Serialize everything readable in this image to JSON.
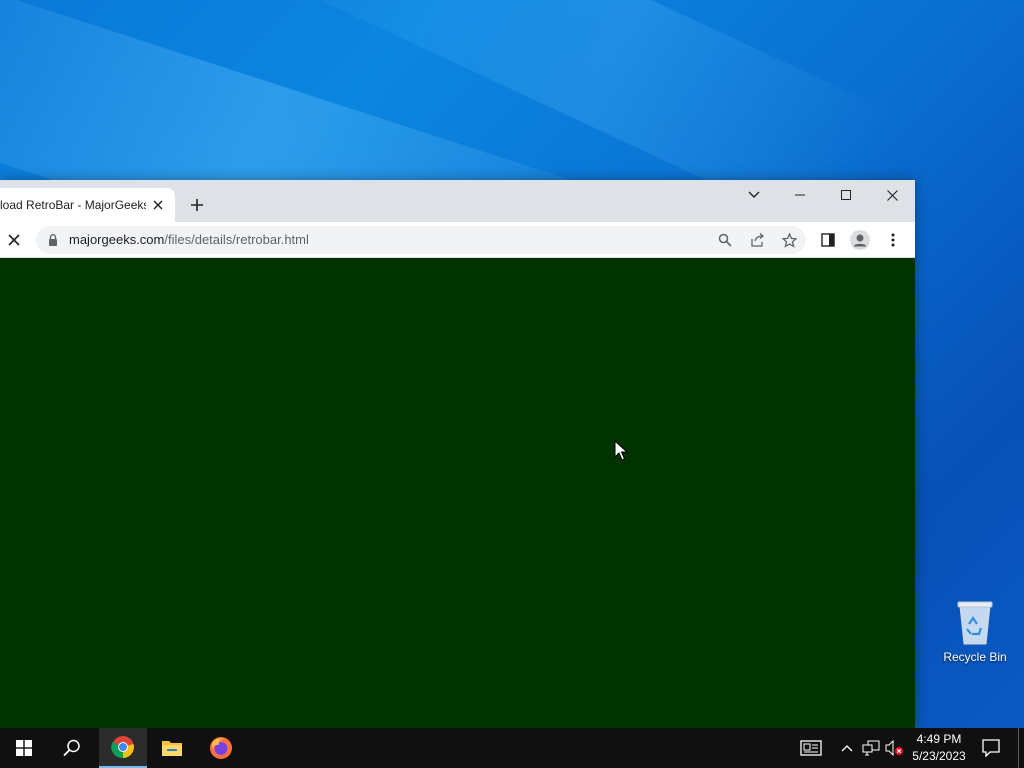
{
  "browser": {
    "tab_title": "load RetroBar - MajorGeeks",
    "url_host": "majorgeeks.com",
    "url_path": "/files/details/retrobar.html"
  },
  "desktop": {
    "recycle_bin_label": "Recycle Bin"
  },
  "taskbar": {
    "time": "4:49 PM",
    "date": "5/23/2023",
    "apps": [
      "start-icon",
      "search-icon",
      "chrome-icon",
      "file-explorer-icon",
      "firefox-icon"
    ]
  },
  "colors": {
    "page_bg": "#003300",
    "tabstrip": "#dee1e6",
    "taskbar": "#101010",
    "accent": "#76b9ed"
  }
}
